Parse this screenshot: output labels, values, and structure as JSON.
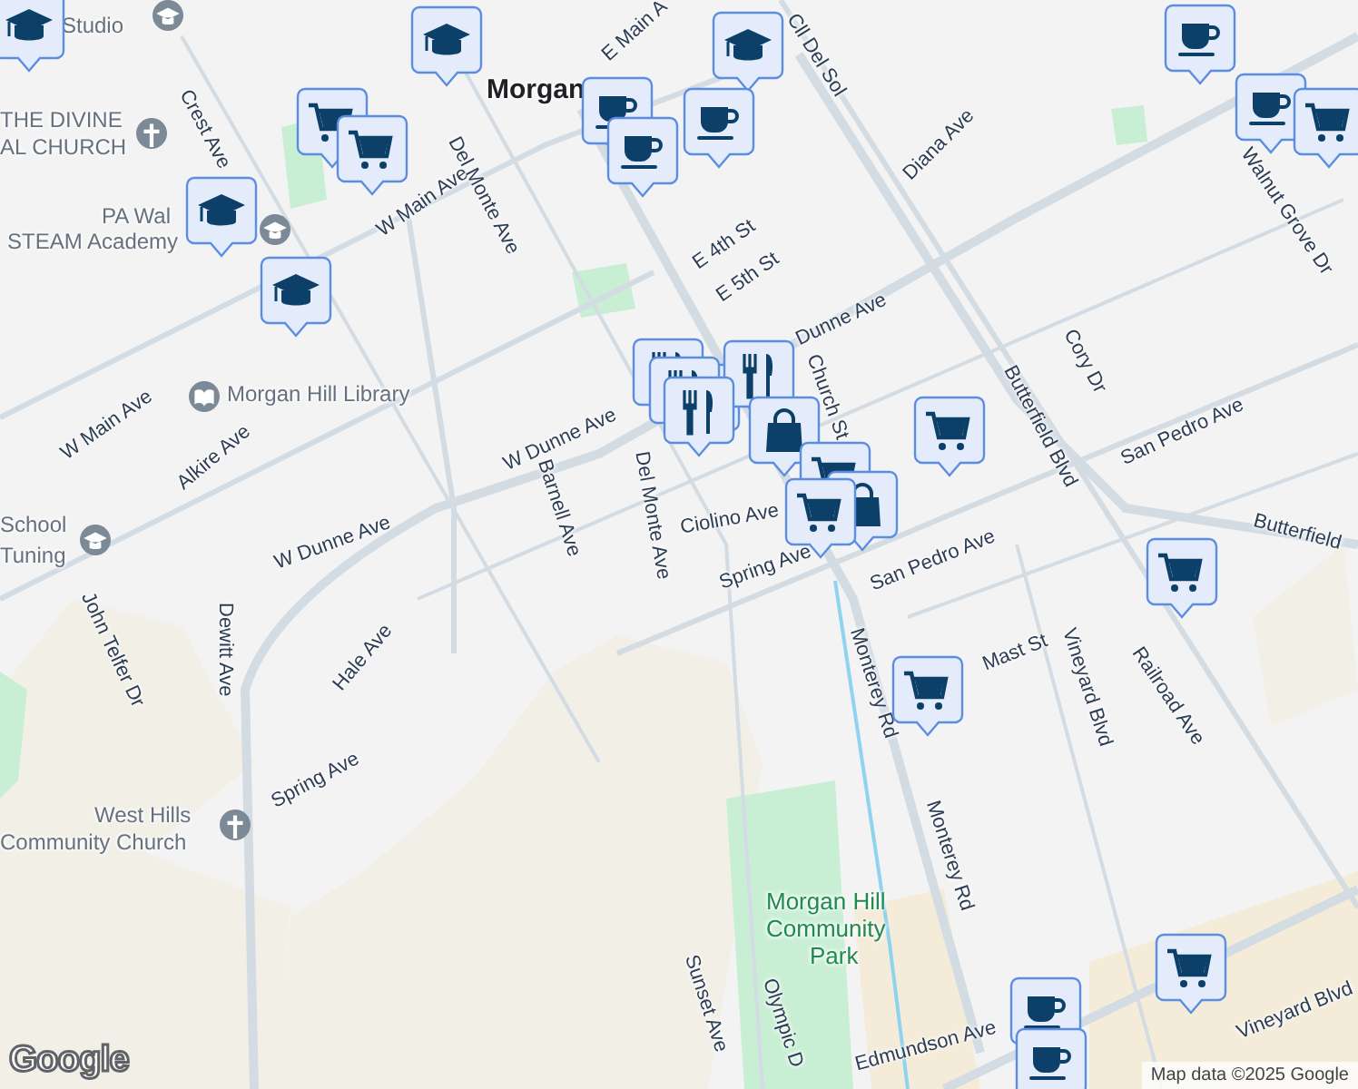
{
  "map": {
    "labels": [
      {
        "text": "Studio",
        "kind": "place"
      },
      {
        "text": "Morgan",
        "kind": "town"
      },
      {
        "text": "E Main A",
        "kind": "street"
      },
      {
        "text": "Cll Del Sol",
        "kind": "street"
      },
      {
        "text": "THE DIVINE",
        "kind": "place"
      },
      {
        "text": "AL CHURCH",
        "kind": "place"
      },
      {
        "text": "PA Wal",
        "kind": "place"
      },
      {
        "text": "STEAM Academy",
        "kind": "place"
      },
      {
        "text": "Crest Ave",
        "kind": "street"
      },
      {
        "text": "W Main Ave",
        "kind": "street"
      },
      {
        "text": "Del Monte Ave",
        "kind": "street"
      },
      {
        "text": "Diana Ave",
        "kind": "street"
      },
      {
        "text": "Walnut Grove Dr",
        "kind": "street"
      },
      {
        "text": "E 4th St",
        "kind": "street"
      },
      {
        "text": "E 5th St",
        "kind": "street"
      },
      {
        "text": "Dunne Ave",
        "kind": "street"
      },
      {
        "text": "Cory Dr",
        "kind": "street"
      },
      {
        "text": "Church St",
        "kind": "street"
      },
      {
        "text": "Butterfield Blvd",
        "kind": "street"
      },
      {
        "text": "San Pedro Ave",
        "kind": "street"
      },
      {
        "text": "Butterfield",
        "kind": "street"
      },
      {
        "text": "Morgan Hill Library",
        "kind": "place"
      },
      {
        "text": "W Main Ave",
        "kind": "street"
      },
      {
        "text": "Alkire Ave",
        "kind": "street"
      },
      {
        "text": "W Dunne Ave",
        "kind": "street"
      },
      {
        "text": "Barnell Ave",
        "kind": "street"
      },
      {
        "text": "Del Monte Ave",
        "kind": "street"
      },
      {
        "text": "Ciolino Ave",
        "kind": "street"
      },
      {
        "text": "W Dunne Ave",
        "kind": "street"
      },
      {
        "text": "School",
        "kind": "place"
      },
      {
        "text": "Tuning",
        "kind": "place"
      },
      {
        "text": "John Telfer Dr",
        "kind": "street"
      },
      {
        "text": "Dewitt Ave",
        "kind": "street"
      },
      {
        "text": "Hale Ave",
        "kind": "street"
      },
      {
        "text": "Spring Ave",
        "kind": "street"
      },
      {
        "text": "Spring Ave",
        "kind": "street"
      },
      {
        "text": "San Pedro Ave",
        "kind": "street"
      },
      {
        "text": "Mast St",
        "kind": "street"
      },
      {
        "text": "Monterey Rd",
        "kind": "street"
      },
      {
        "text": "Vineyard Blvd",
        "kind": "street"
      },
      {
        "text": "Railroad Ave",
        "kind": "street"
      },
      {
        "text": "Monterey Rd",
        "kind": "street"
      },
      {
        "text": "West Hills",
        "kind": "place"
      },
      {
        "text": "Community Church",
        "kind": "place"
      },
      {
        "text": "Morgan Hill",
        "kind": "park"
      },
      {
        "text": "Community",
        "kind": "park"
      },
      {
        "text": "Park",
        "kind": "park"
      },
      {
        "text": "Sunset Ave",
        "kind": "street"
      },
      {
        "text": "Olympic D",
        "kind": "street"
      },
      {
        "text": "Edmundson Ave",
        "kind": "street"
      },
      {
        "text": "Vineyard Blvd",
        "kind": "street"
      }
    ],
    "places": [
      {
        "kind": "school"
      },
      {
        "kind": "church"
      },
      {
        "kind": "school"
      },
      {
        "kind": "library"
      },
      {
        "kind": "school"
      },
      {
        "kind": "church"
      }
    ],
    "markers": [
      {
        "kind": "school"
      },
      {
        "kind": "school"
      },
      {
        "kind": "school"
      },
      {
        "kind": "school"
      },
      {
        "kind": "school"
      },
      {
        "kind": "cart"
      },
      {
        "kind": "cart"
      },
      {
        "kind": "coffee"
      },
      {
        "kind": "coffee"
      },
      {
        "kind": "coffee"
      },
      {
        "kind": "coffee"
      },
      {
        "kind": "coffee"
      },
      {
        "kind": "cart"
      },
      {
        "kind": "food"
      },
      {
        "kind": "food"
      },
      {
        "kind": "food"
      },
      {
        "kind": "food"
      },
      {
        "kind": "food"
      },
      {
        "kind": "bag"
      },
      {
        "kind": "cart"
      },
      {
        "kind": "bag"
      },
      {
        "kind": "cart"
      },
      {
        "kind": "cart"
      },
      {
        "kind": "cart"
      },
      {
        "kind": "cart"
      },
      {
        "kind": "cart"
      },
      {
        "kind": "coffee"
      },
      {
        "kind": "coffee"
      }
    ],
    "logo": "Google",
    "attribution": "Map data ©2025 Google"
  }
}
